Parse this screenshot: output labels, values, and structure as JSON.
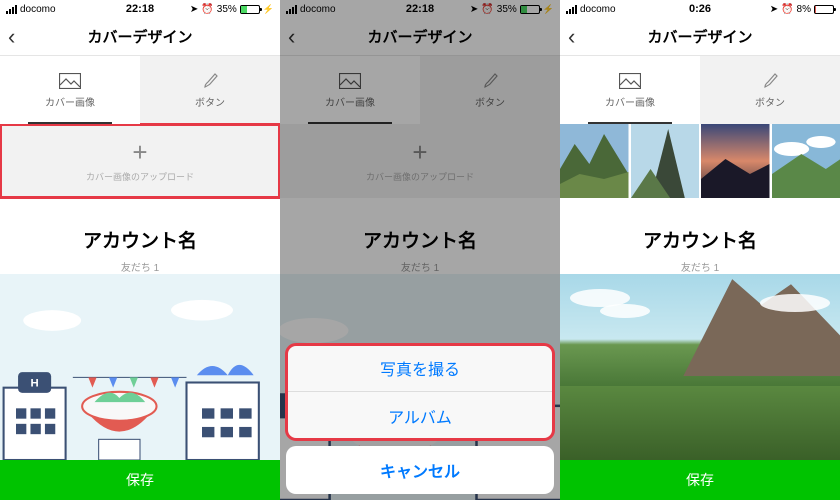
{
  "screens": [
    {
      "status": {
        "carrier": "docomo",
        "time": "22:18",
        "battery_pct": "35%",
        "battery_fill": 35
      },
      "header": {
        "title": "カバーデザイン"
      },
      "tabs": {
        "cover_label": "カバー画像",
        "button_label": "ボタン"
      },
      "upload": {
        "caption": "カバー画像のアップロード"
      },
      "account": {
        "name": "アカウント名",
        "friends": "友だち 1"
      },
      "save_label": "保存"
    },
    {
      "status": {
        "carrier": "docomo",
        "time": "22:18",
        "battery_pct": "35%",
        "battery_fill": 35
      },
      "header": {
        "title": "カバーデザイン"
      },
      "tabs": {
        "cover_label": "カバー画像",
        "button_label": "ボタン"
      },
      "upload": {
        "caption": "カバー画像のアップロード"
      },
      "account": {
        "name": "アカウント名",
        "friends": "友だち 1"
      },
      "sheet": {
        "take_photo": "写真を撮る",
        "album": "アルバム",
        "cancel": "キャンセル"
      }
    },
    {
      "status": {
        "carrier": "docomo",
        "time": "0:26",
        "battery_pct": "8%",
        "battery_fill": 8
      },
      "header": {
        "title": "カバーデザイン"
      },
      "tabs": {
        "cover_label": "カバー画像",
        "button_label": "ボタン"
      },
      "account": {
        "name": "アカウント名",
        "friends": "友だち 1"
      },
      "save_label": "保存"
    }
  ]
}
